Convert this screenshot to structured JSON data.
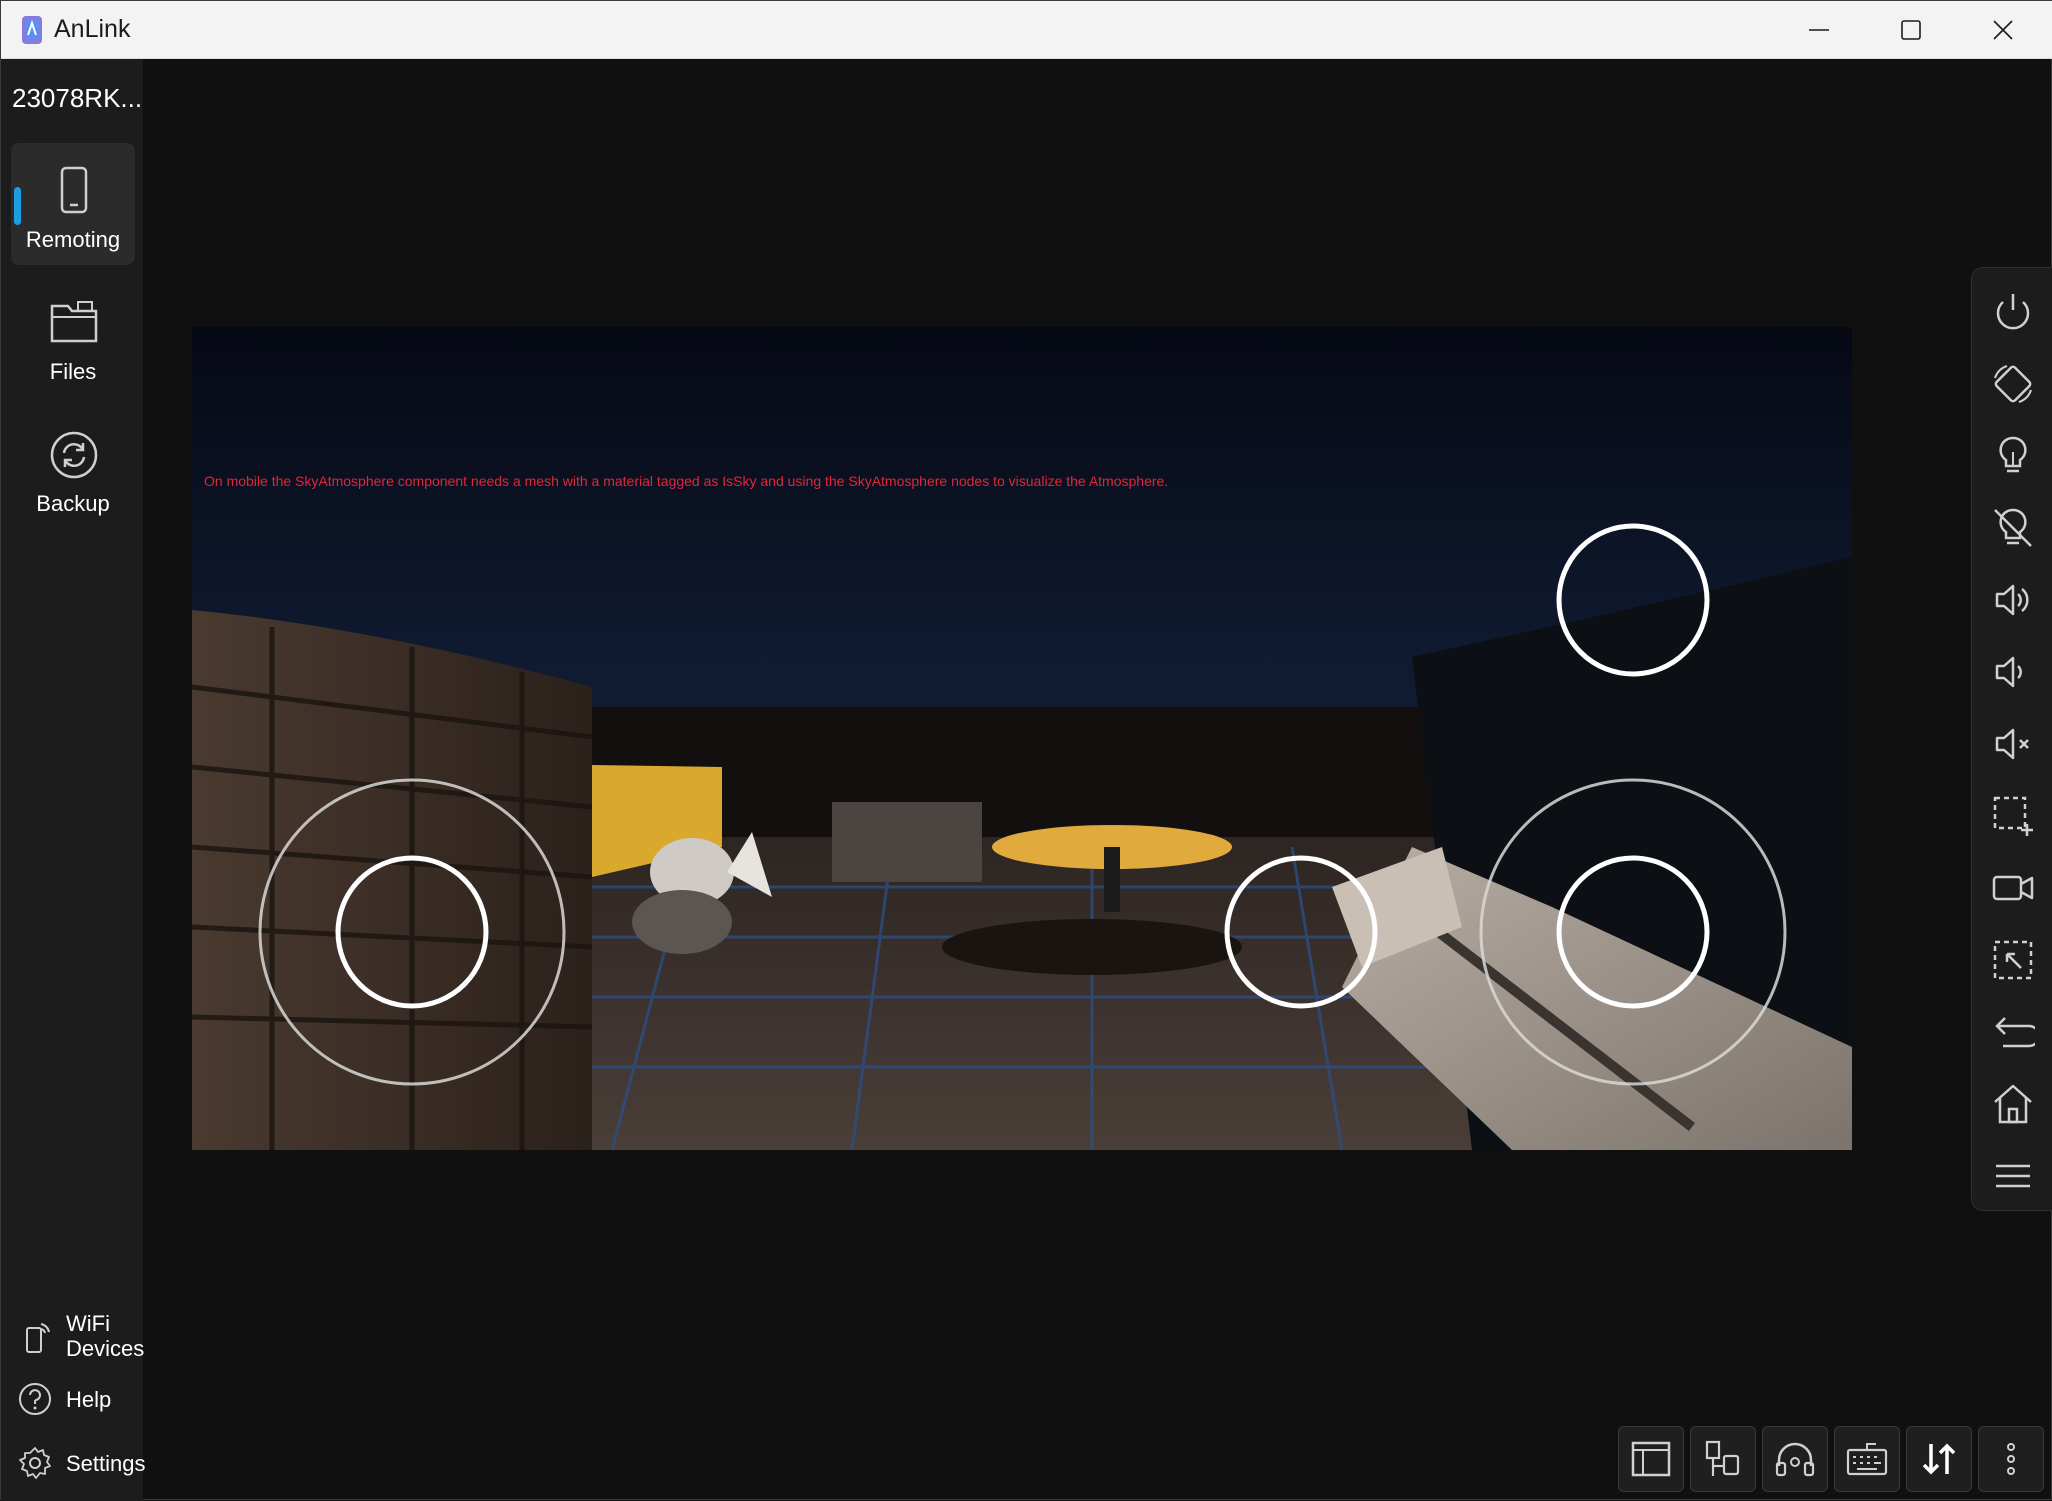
{
  "app": {
    "title": "AnLink"
  },
  "window_controls": [
    "minimize-icon",
    "maximize-icon",
    "close-icon"
  ],
  "sidebar": {
    "device_name": "23078RK...",
    "nav": [
      {
        "label": "Remoting",
        "icon": "phone-icon",
        "active": true
      },
      {
        "label": "Files",
        "icon": "folder-icon",
        "active": false
      },
      {
        "label": "Backup",
        "icon": "sync-icon",
        "active": false
      }
    ],
    "bottom": [
      {
        "label": "WiFi Devices",
        "line1": "WiFi",
        "line2": "Devices",
        "icon": "wifi-device-icon"
      },
      {
        "label": "Help",
        "icon": "help-icon"
      },
      {
        "label": "Settings",
        "icon": "gear-icon"
      }
    ],
    "accent_color": "#1aa0e0"
  },
  "screen": {
    "message": "On mobile the SkyAtmosphere component needs a mesh with a material tagged as IsSky and using the SkyAtmosphere nodes to visualize the Atmosphere.",
    "message_color": "#e0263a"
  },
  "right_toolbar": [
    "power-icon",
    "rotate-screen-icon",
    "screen-light-on-icon",
    "screen-light-off-icon",
    "volume-up-icon",
    "volume-down-icon",
    "mute-icon",
    "screenshot-region-icon",
    "record-video-icon",
    "region-capture-icon",
    "back-icon",
    "home-icon",
    "menu-icon"
  ],
  "bottom_toolbar": [
    "window-layout-icon",
    "usb-connection-icon",
    "audio-headphones-icon",
    "keyboard-icon",
    "transfer-icon",
    "more-vertical-icon"
  ]
}
